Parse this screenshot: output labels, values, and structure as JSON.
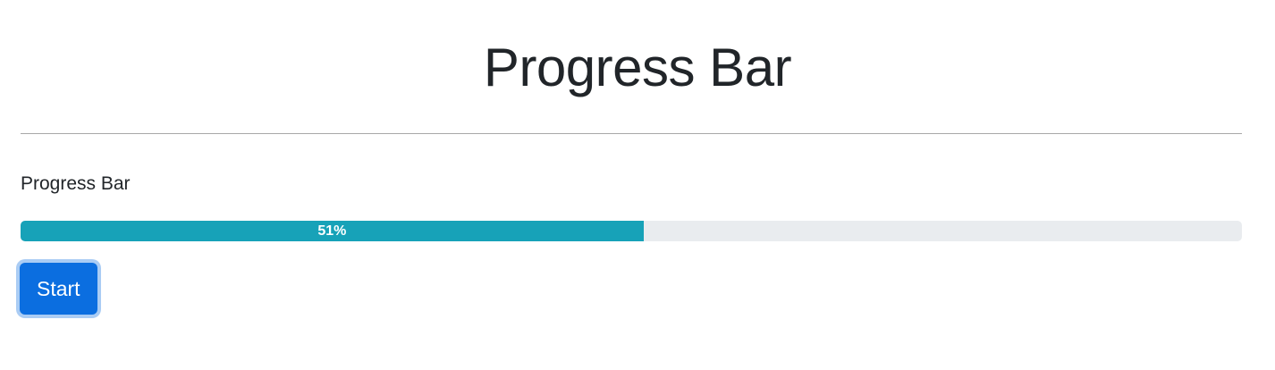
{
  "header": {
    "title": "Progress Bar"
  },
  "section": {
    "label": "Progress Bar"
  },
  "progress": {
    "value_percent": 51,
    "label": "51%",
    "fill_color": "#17a2b8",
    "track_color": "#e9ecef"
  },
  "controls": {
    "start_label": "Start",
    "button_color": "#0b6ee0"
  }
}
